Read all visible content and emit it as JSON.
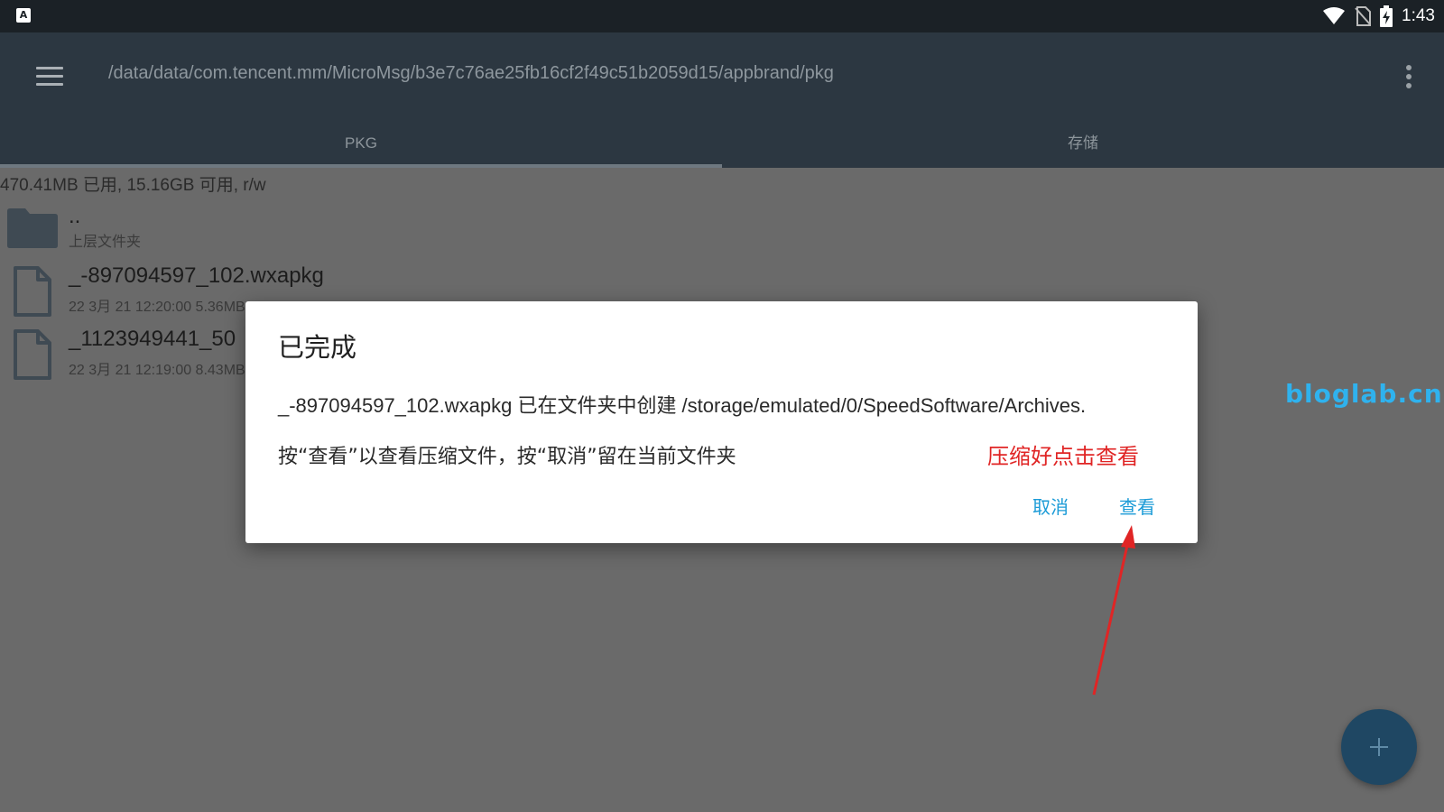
{
  "status_bar": {
    "app_icon_letter": "A",
    "time": "1:43",
    "icons": [
      "wifi-icon",
      "no-sim-icon",
      "battery-charging-icon"
    ]
  },
  "toolbar": {
    "menu_icon": "hamburger-menu-icon",
    "path": "/data/data/com.tencent.mm/MicroMsg/b3e7c76ae25fb16cf2f49c51b2059d15/appbrand/pkg",
    "overflow_icon": "more-vert-icon"
  },
  "tabs": [
    {
      "label": "PKG",
      "selected": true
    },
    {
      "label": "存储",
      "selected": false
    }
  ],
  "storage_info": "470.41MB 已用, 15.16GB 可用, r/w",
  "files": [
    {
      "type": "folder",
      "icon": "folder-icon",
      "name": "..",
      "subtitle": "上层文件夹"
    },
    {
      "type": "file",
      "icon": "file-icon",
      "name": "_-897094597_102.wxapkg",
      "subtitle": "22 3月 21 12:20:00  5.36MB  -rw-"
    },
    {
      "type": "file",
      "icon": "file-icon",
      "name": "_1123949441_50",
      "subtitle": "22 3月 21 12:19:00  8.43MB"
    }
  ],
  "dialog": {
    "title": "已完成",
    "message1": "_-897094597_102.wxapkg 已在文件夹中创建 /storage/emulated/0/SpeedSoftware/Archives.",
    "message2": "按“查看”以查看压缩文件，按“取消”留在当前文件夹",
    "cancel_label": "取消",
    "view_label": "查看"
  },
  "annotation": "压缩好点击查看",
  "watermark": "bloglab.cn",
  "fab_icon": "plus-icon",
  "colors": {
    "status_bar": "#1b2126",
    "toolbar": "#2c3741",
    "scrim_background": "#6a6a6a",
    "dialog_button": "#1b9bd7",
    "annotation": "#e02525",
    "watermark": "#2fb2ee",
    "fab": "#1f4763"
  }
}
